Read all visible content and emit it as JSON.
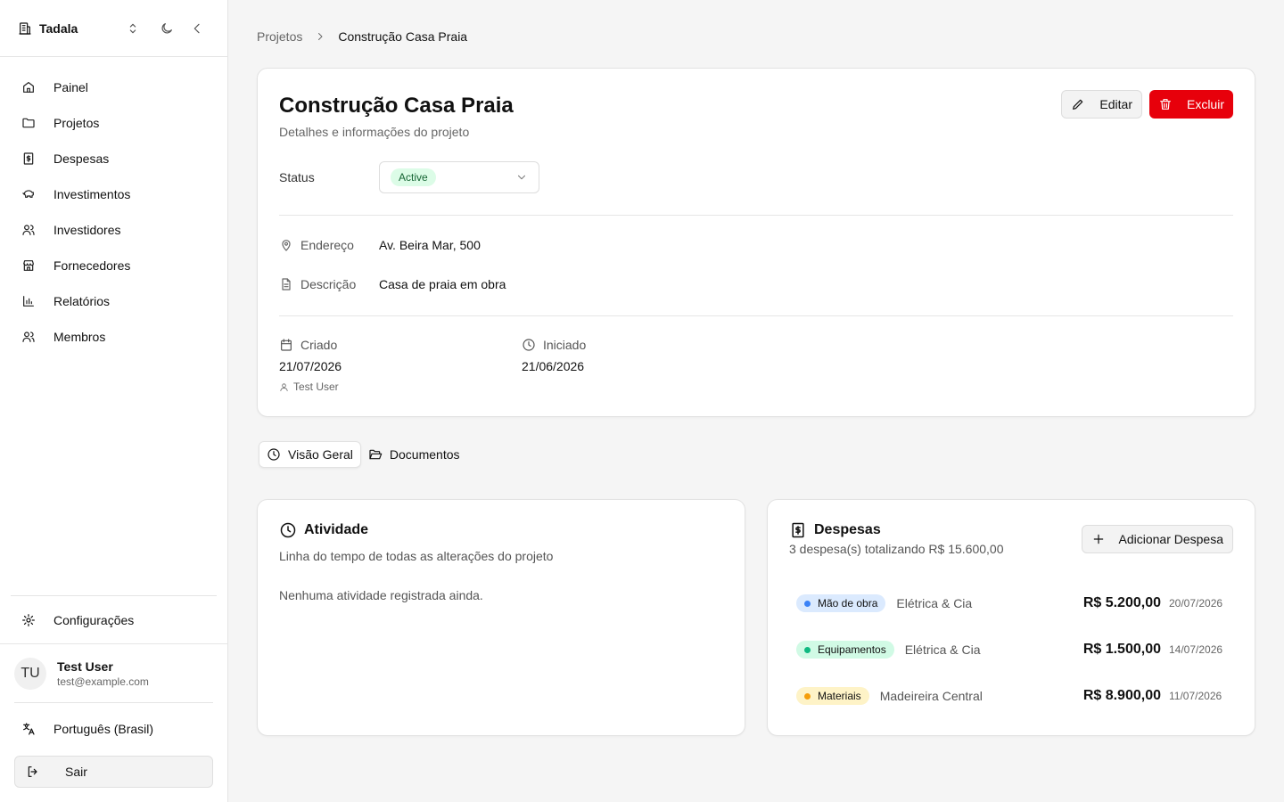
{
  "sidebar": {
    "brand": "Tadala",
    "nav": [
      {
        "label": "Painel",
        "icon": "home-icon"
      },
      {
        "label": "Projetos",
        "icon": "folder-icon"
      },
      {
        "label": "Despesas",
        "icon": "dollar-receipt-icon"
      },
      {
        "label": "Investimentos",
        "icon": "piggy-bank-icon"
      },
      {
        "label": "Investidores",
        "icon": "users-icon"
      },
      {
        "label": "Fornecedores",
        "icon": "store-icon"
      },
      {
        "label": "Relatórios",
        "icon": "bar-chart-icon"
      },
      {
        "label": "Membros",
        "icon": "users-icon"
      }
    ],
    "settings_label": "Configurações",
    "user": {
      "initials": "TU",
      "name": "Test User",
      "email": "test@example.com"
    },
    "language": "Português (Brasil)",
    "logout_label": "Sair"
  },
  "breadcrumb": {
    "parent": "Projetos",
    "current": "Construção Casa Praia"
  },
  "project": {
    "title": "Construção Casa Praia",
    "subtitle": "Detalhes e informações do projeto",
    "edit_label": "Editar",
    "delete_label": "Excluir",
    "status_label": "Status",
    "status_value": "Active",
    "address_label": "Endereço",
    "address_value": "Av. Beira Mar, 500",
    "description_label": "Descrição",
    "description_value": "Casa de praia em obra",
    "created_label": "Criado",
    "created_value": "21/07/2026",
    "created_by": "Test User",
    "started_label": "Iniciado",
    "started_value": "21/06/2026"
  },
  "tabs": [
    {
      "label": "Visão Geral",
      "active": true
    },
    {
      "label": "Documentos",
      "active": false
    }
  ],
  "activity": {
    "title": "Atividade",
    "subtitle": "Linha do tempo de todas as alterações do projeto",
    "empty": "Nenhuma atividade registrada ainda."
  },
  "expenses": {
    "title": "Despesas",
    "subtitle": "3 despesa(s) totalizando R$ 15.600,00",
    "add_label": "Adicionar Despesa",
    "items": [
      {
        "category": "Mão de obra",
        "supplier": "Elétrica & Cia",
        "amount": "R$ 5.200,00",
        "date": "20/07/2026",
        "dot": "#3b82f6",
        "bg": "#dbeafe"
      },
      {
        "category": "Equipamentos",
        "supplier": "Elétrica & Cia",
        "amount": "R$ 1.500,00",
        "date": "14/07/2026",
        "dot": "#10b981",
        "bg": "#d1fae5"
      },
      {
        "category": "Materiais",
        "supplier": "Madeireira Central",
        "amount": "R$ 8.900,00",
        "date": "11/07/2026",
        "dot": "#f59e0b",
        "bg": "#fef3c7"
      }
    ]
  },
  "colors": {
    "danger": "#e7000b",
    "success_bg": "#dcfce7",
    "success_text": "#166534"
  }
}
